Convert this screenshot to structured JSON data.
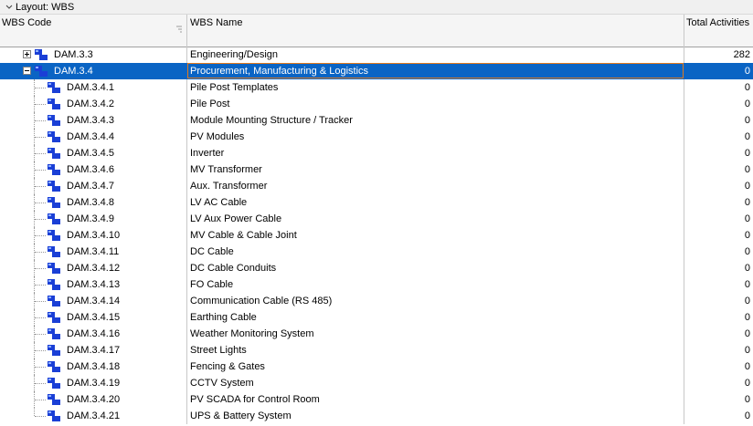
{
  "layout": {
    "label": "Layout: WBS"
  },
  "columns": {
    "wbs_code": "WBS Code",
    "wbs_name": "WBS Name",
    "total_activities": "Total Activities"
  },
  "rows": [
    {
      "code": "DAM.3.3",
      "name": "Engineering/Design",
      "activities": "282",
      "level": 0,
      "expander": "plus",
      "selected": false
    },
    {
      "code": "DAM.3.4",
      "name": "Procurement, Manufacturing & Logistics",
      "activities": "0",
      "level": 0,
      "expander": "minus",
      "selected": true
    },
    {
      "code": "DAM.3.4.1",
      "name": "Pile Post Templates",
      "activities": "0",
      "level": 1
    },
    {
      "code": "DAM.3.4.2",
      "name": "Pile Post",
      "activities": "0",
      "level": 1
    },
    {
      "code": "DAM.3.4.3",
      "name": "Module Mounting Structure / Tracker",
      "activities": "0",
      "level": 1
    },
    {
      "code": "DAM.3.4.4",
      "name": "PV Modules",
      "activities": "0",
      "level": 1
    },
    {
      "code": "DAM.3.4.5",
      "name": "Inverter",
      "activities": "0",
      "level": 1
    },
    {
      "code": "DAM.3.4.6",
      "name": "MV Transformer",
      "activities": "0",
      "level": 1
    },
    {
      "code": "DAM.3.4.7",
      "name": "Aux. Transformer",
      "activities": "0",
      "level": 1
    },
    {
      "code": "DAM.3.4.8",
      "name": "LV AC Cable",
      "activities": "0",
      "level": 1
    },
    {
      "code": "DAM.3.4.9",
      "name": "LV Aux Power Cable",
      "activities": "0",
      "level": 1
    },
    {
      "code": "DAM.3.4.10",
      "name": "MV Cable & Cable Joint",
      "activities": "0",
      "level": 1
    },
    {
      "code": "DAM.3.4.11",
      "name": "DC Cable",
      "activities": "0",
      "level": 1
    },
    {
      "code": "DAM.3.4.12",
      "name": "DC Cable Conduits",
      "activities": "0",
      "level": 1
    },
    {
      "code": "DAM.3.4.13",
      "name": "FO Cable",
      "activities": "0",
      "level": 1
    },
    {
      "code": "DAM.3.4.14",
      "name": "Communication Cable (RS 485)",
      "activities": "0",
      "level": 1
    },
    {
      "code": "DAM.3.4.15",
      "name": "Earthing Cable",
      "activities": "0",
      "level": 1
    },
    {
      "code": "DAM.3.4.16",
      "name": "Weather Monitoring System",
      "activities": "0",
      "level": 1
    },
    {
      "code": "DAM.3.4.17",
      "name": "Street Lights",
      "activities": "0",
      "level": 1
    },
    {
      "code": "DAM.3.4.18",
      "name": "Fencing & Gates",
      "activities": "0",
      "level": 1
    },
    {
      "code": "DAM.3.4.19",
      "name": "CCTV System",
      "activities": "0",
      "level": 1
    },
    {
      "code": "DAM.3.4.20",
      "name": "PV SCADA for Control Room",
      "activities": "0",
      "level": 1
    },
    {
      "code": "DAM.3.4.21",
      "name": "UPS & Battery System",
      "activities": "0",
      "level": 1
    }
  ],
  "colors": {
    "selection": "#0a64c4",
    "edit_border": "#e07a1e",
    "wbs_icon_blue": "#1a3fd6"
  },
  "icons": {
    "layout_toggle": "chevron-down-icon",
    "wbs_node": "wbs-node-icon",
    "expand": "plus-box-icon",
    "collapse": "minus-box-icon"
  }
}
